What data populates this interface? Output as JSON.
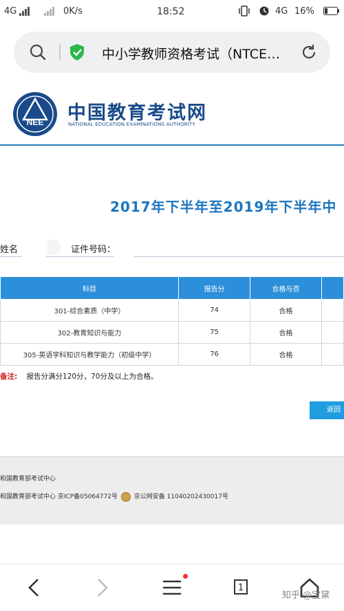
{
  "status_bar": {
    "net1": "4G",
    "speed": "0K/s",
    "time": "18:52",
    "net2": "4G",
    "battery": "16%"
  },
  "address_bar": {
    "title": "中小学教师资格考试（NTCE…"
  },
  "header": {
    "brand_cn": "中国教育考试网",
    "brand_en": "NATIONAL EDUCATION EXAMINATIONS AUTHORITY",
    "logo_text": "NEEA"
  },
  "page_title": "2017年下半年至2019年下半年中",
  "form": {
    "name_label": "姓名",
    "id_label": "证件号码："
  },
  "table": {
    "headers": [
      "科目",
      "报告分",
      "合格与否"
    ],
    "rows": [
      {
        "subject": "301-综合素质（中学）",
        "score": "74",
        "result": "合格"
      },
      {
        "subject": "302-教育知识与能力",
        "score": "75",
        "result": "合格"
      },
      {
        "subject": "305-英语学科知识与教学能力（初级中学）",
        "score": "76",
        "result": "合格"
      }
    ]
  },
  "note": {
    "label": "备注:",
    "text": "报告分满分120分，70分及以上为合格。"
  },
  "return_button": "返回",
  "footer": {
    "line1": "和国教育部考试中心",
    "line2a": "和国教育部考试中心 京ICP备05064772号",
    "line2b": "京公网安备 11040202430017号"
  },
  "nav": {
    "tab_count": "1"
  },
  "watermark": "知乎 @宝黛",
  "colors": {
    "brand_blue": "#1a4a8a",
    "table_header": "#2c8fd9",
    "title_blue": "#1b75c0",
    "note_red": "#d21c1c",
    "button_blue": "#1e9de0",
    "secure_green": "#2db84a"
  }
}
